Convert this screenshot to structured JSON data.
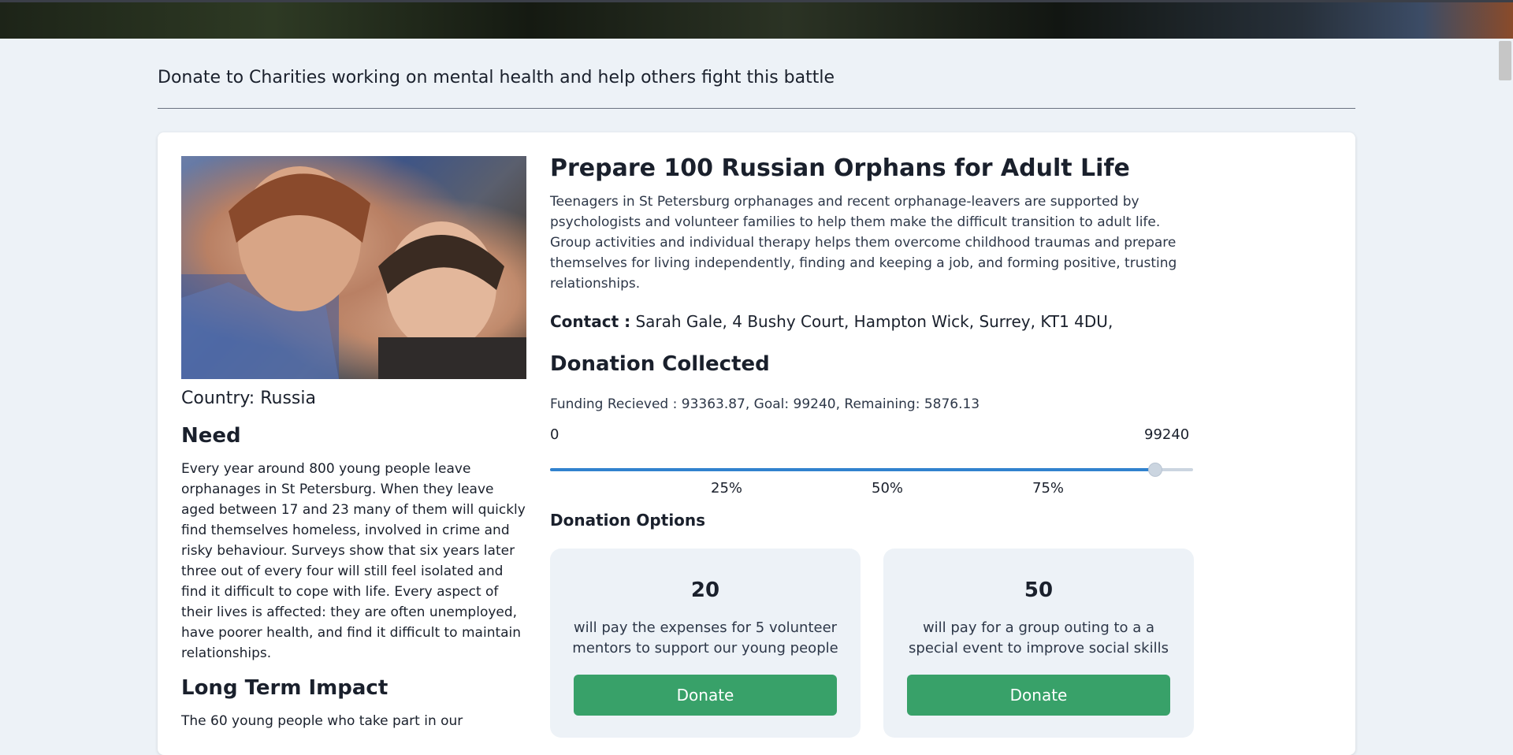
{
  "page": {
    "heading": "Donate to Charities working on mental health and help others fight this battle"
  },
  "project": {
    "country_label": "Country: Russia",
    "need_title": "Need",
    "need_text": "Every year around 800 young people leave orphanages in St Petersburg. When they leave aged between 17 and 23 many of them will quickly find themselves homeless, involved in crime and risky behaviour. Surveys show that six years later three out of every four will still feel isolated and find it difficult to cope with life. Every aspect of their lives is affected: they are often unemployed, have poorer health, and find it difficult to maintain relationships.",
    "impact_title": "Long Term Impact",
    "impact_text": "The 60 young people who take part in our",
    "title": "Prepare 100 Russian Orphans for Adult Life",
    "description": "Teenagers in St Petersburg orphanages and recent orphanage-leavers are supported by psychologists and volunteer families to help them make the difficult transition to adult life. Group activities and individual therapy helps them overcome childhood traumas and prepare themselves for living independently, finding and keeping a job, and forming positive, trusting relationships.",
    "contact_label": "Contact :",
    "contact_value": " Sarah Gale, 4 Bushy Court, Hampton Wick, Surrey, KT1 4DU,"
  },
  "donation": {
    "title": "Donation Collected",
    "funding_line": "Funding Recieved : 93363.87, Goal: 99240, Remaining: 5876.13",
    "range_min": "0",
    "range_max": "99240",
    "progress_fraction": 0.9408,
    "ticks": [
      "25%",
      "50%",
      "75%"
    ],
    "accent_color": "#3182ce"
  },
  "options": {
    "title": "Donation Options",
    "items": [
      {
        "amount": "20",
        "description": "will pay the expenses for 5 volunteer mentors to support our young people",
        "button_label": "Donate"
      },
      {
        "amount": "50",
        "description": "will pay for a group outing to a a special event to improve social skills",
        "button_label": "Donate"
      }
    ],
    "button_color": "#38a169"
  }
}
